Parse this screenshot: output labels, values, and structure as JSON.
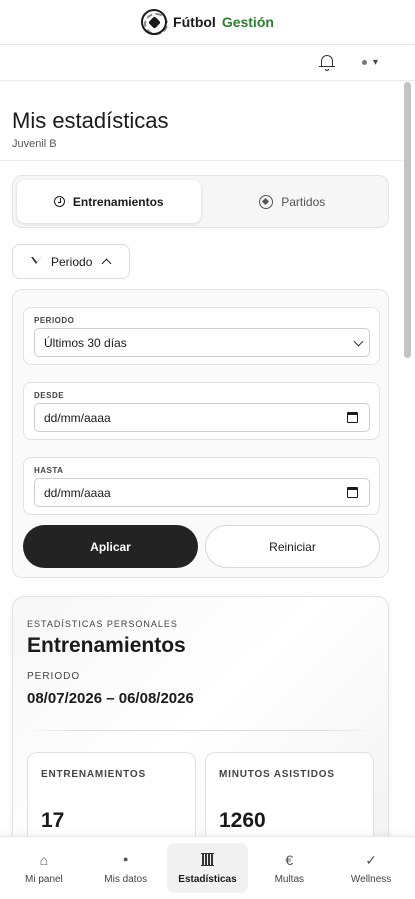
{
  "header": {
    "brand_part1": "Fútbol",
    "brand_part2": "Gestión",
    "brand_accent": "#2e7d32"
  },
  "toolbar": {
    "notifications_icon": "bell-icon",
    "user_menu_icon": "chevron-down-icon"
  },
  "page": {
    "title": "Mis estadísticas",
    "subtitle": "Juvenil B"
  },
  "tabs": [
    {
      "label": "Entrenamientos",
      "icon": "clock-icon",
      "active": true
    },
    {
      "label": "Partidos",
      "icon": "soccer-ball-icon",
      "active": false
    }
  ],
  "filter_toggle": {
    "label": "Periodo"
  },
  "filters": {
    "period_label": "PERIODO",
    "period_value": "Últimos 30 días",
    "from_label": "DESDE",
    "from_placeholder": "dd/mm/aaaa",
    "to_label": "HASTA",
    "to_placeholder": "dd/mm/aaaa",
    "apply_label": "Aplicar",
    "reset_label": "Reiniciar"
  },
  "stats": {
    "eyebrow": "ESTADÍSTICAS PERSONALES",
    "title": "Entrenamientos",
    "period_label": "PERIODO",
    "period_range": "08/07/2026 – 06/08/2026",
    "metrics": [
      {
        "label": "ENTRENAMIENTOS",
        "value": "17"
      },
      {
        "label": "MINUTOS ASISTIDOS",
        "value": "1260"
      }
    ]
  },
  "bottom_nav": [
    {
      "label": "Mi panel",
      "icon": "home-icon",
      "glyph": "⌂"
    },
    {
      "label": "Mis datos",
      "icon": "dot-icon",
      "glyph": "●"
    },
    {
      "label": "Estadísticas",
      "icon": "bar-chart-icon",
      "glyph": "",
      "active": true
    },
    {
      "label": "Multas",
      "icon": "euro-icon",
      "glyph": "€"
    },
    {
      "label": "Wellness",
      "icon": "checkmark-icon",
      "glyph": "✓"
    }
  ]
}
